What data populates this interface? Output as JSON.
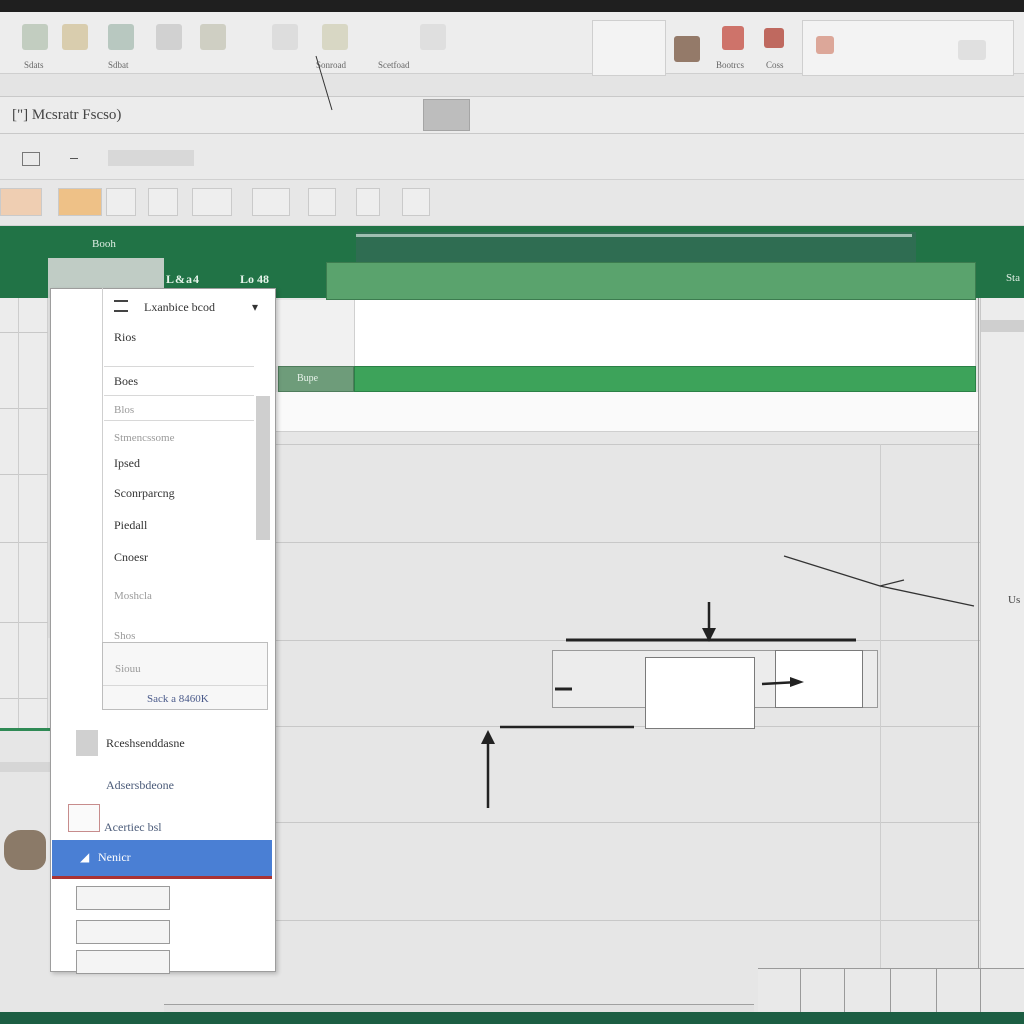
{
  "ribbon": {
    "labels": [
      "Sdats",
      "Sdbat",
      "Sonroad",
      "Scetfoad",
      "Bootrcs",
      "Coss"
    ]
  },
  "formula_bar": {
    "name_box": "[\"] Mcsratr Fscso)"
  },
  "header_band": {
    "left_label": "Booh",
    "mid_label_1": "L&a4",
    "mid_label_2": "Lo 48",
    "right_label": "Sta"
  },
  "table": {
    "row_label": "Bupe"
  },
  "right_side_label": "Us",
  "menu": {
    "header": "Lxanbice bcod",
    "items": [
      {
        "label": "Rios"
      },
      {
        "label": "Boes"
      },
      {
        "label": "Blos"
      },
      {
        "label": "Stmencssome"
      },
      {
        "label": "Ipsed"
      },
      {
        "label": "Sconrparcng"
      },
      {
        "label": "Piedall"
      },
      {
        "label": "Cnoesr"
      },
      {
        "label": "Moshcla"
      },
      {
        "label": "Shos"
      },
      {
        "label": "Siouu"
      },
      {
        "label": "Sack a 8460K"
      },
      {
        "label": "Rceshsenddasne"
      },
      {
        "label": "Adsersbdeone"
      },
      {
        "label": "Acertiec bsl"
      },
      {
        "label": "Nenicr"
      }
    ]
  }
}
